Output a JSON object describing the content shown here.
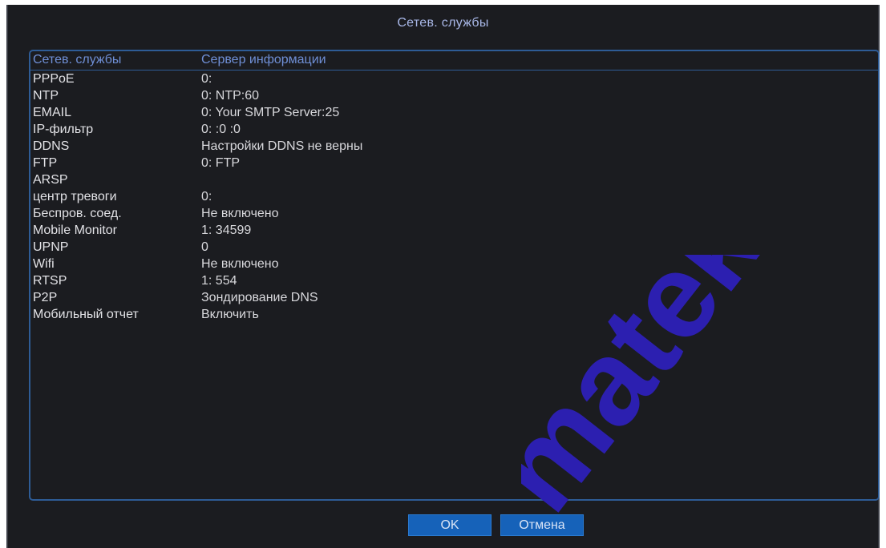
{
  "dialog": {
    "title": "Сетев. службы"
  },
  "table": {
    "headers": [
      "Сетев. службы",
      "Сервер информации"
    ],
    "rows": [
      [
        "PPPoE",
        "0:"
      ],
      [
        "NTP",
        "0: NTP:60"
      ],
      [
        "EMAIL",
        "0: Your SMTP Server:25"
      ],
      [
        "IP-фильтр",
        "0: :0 :0"
      ],
      [
        "DDNS",
        "Настройки DDNS не верны"
      ],
      [
        "FTP",
        "0: FTP"
      ],
      [
        "ARSP",
        ""
      ],
      [
        "центр тревоги",
        "0:"
      ],
      [
        "Беспров. соед.",
        "Не включено"
      ],
      [
        "Mobile Monitor",
        "1: 34599"
      ],
      [
        "UPNP",
        "0"
      ],
      [
        "Wifi",
        "Не включено"
      ],
      [
        "RTSP",
        "1: 554"
      ],
      [
        "P2P",
        "Зондирование DNS"
      ],
      [
        "Мобильный отчет",
        "Включить"
      ]
    ]
  },
  "buttons": {
    "ok": "OK",
    "cancel": "Отмена"
  },
  "watermark": {
    "text": "matek",
    "color": "#2c1fb0"
  }
}
